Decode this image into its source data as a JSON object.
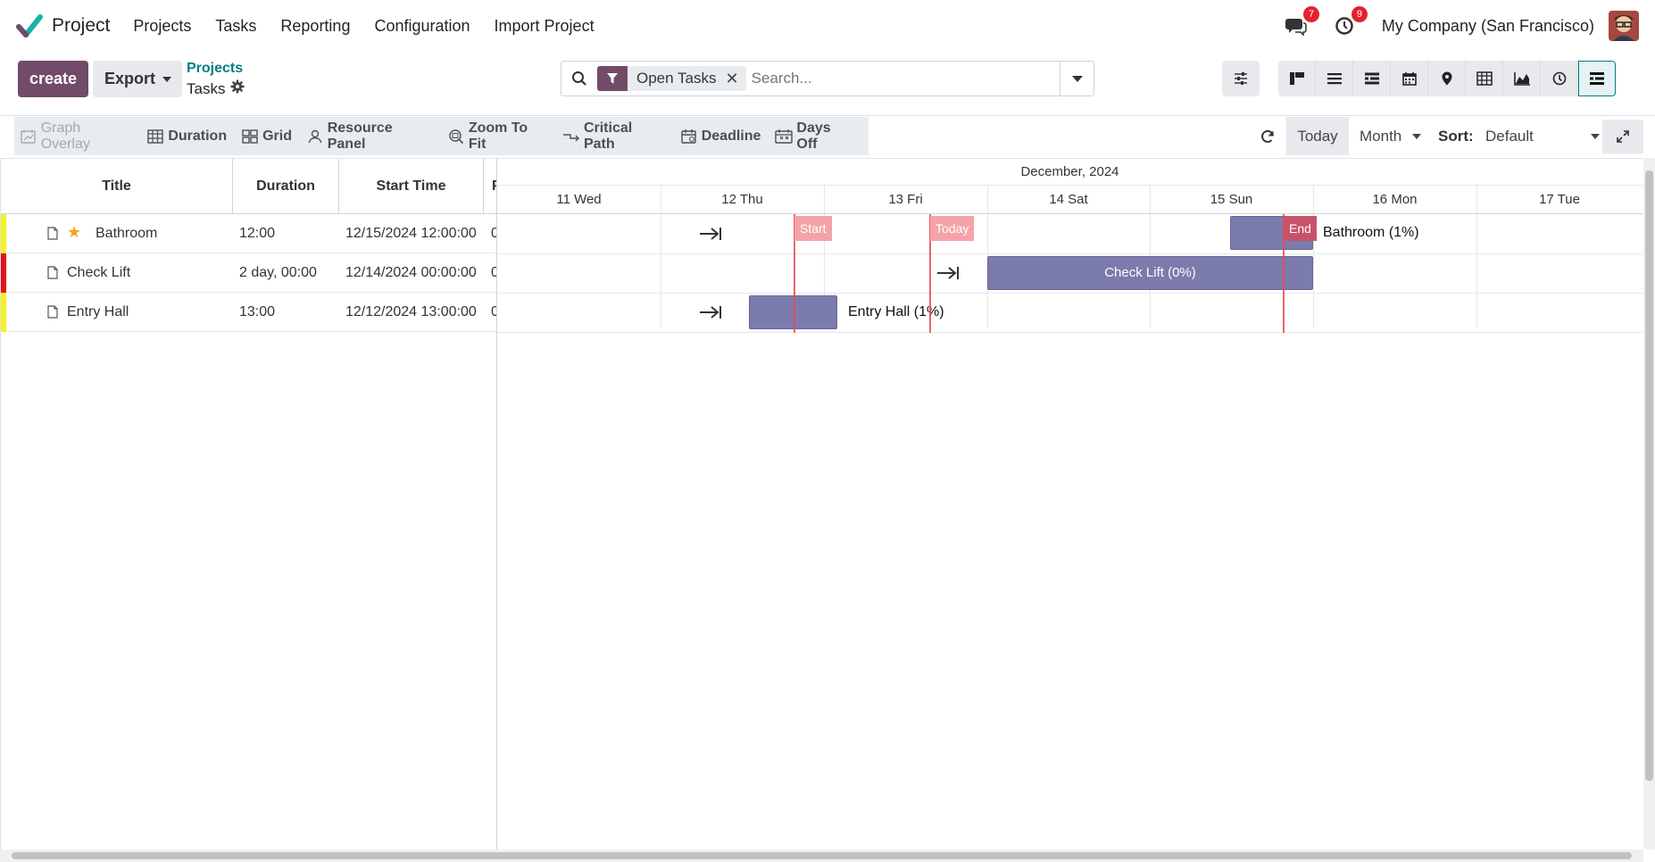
{
  "navbar": {
    "app_name": "Project",
    "menu": [
      "Projects",
      "Tasks",
      "Reporting",
      "Configuration",
      "Import Project"
    ],
    "messages_count": "7",
    "activities_count": "9",
    "company": "My Company (San Francisco)"
  },
  "control_panel": {
    "create_label": "create",
    "export_label": "Export",
    "breadcrumb_parent": "Projects",
    "breadcrumb_current": "Tasks",
    "facet_label": "Open Tasks",
    "search_placeholder": "Search..."
  },
  "gantt_toolbar": {
    "items": [
      "Graph Overlay",
      "Duration",
      "Grid",
      "Resource Panel",
      "Zoom To Fit",
      "Critical Path",
      "Deadline",
      "Days Off"
    ],
    "today_label": "Today",
    "range_label": "Month",
    "sort_label": "Sort:",
    "sort_value": "Default"
  },
  "table": {
    "columns": [
      "Title",
      "Duration",
      "Start Time",
      "P"
    ],
    "rows": [
      {
        "title": "Bathroom",
        "duration": "12:00",
        "start": "12/15/2024 12:00:00",
        "extra": "0",
        "flag": "#f5f125",
        "starred": true
      },
      {
        "title": "Check Lift",
        "duration": "2 day, 00:00",
        "start": "12/14/2024 00:00:00",
        "extra": "0",
        "flag": "#e5101d",
        "starred": false
      },
      {
        "title": "Entry Hall",
        "duration": "13:00",
        "start": "12/12/2024 13:00:00",
        "extra": "0",
        "flag": "#f5f125",
        "starred": false
      }
    ]
  },
  "timeline": {
    "month": "December, 2024",
    "days": [
      "11 Wed",
      "12 Thu",
      "13 Fri",
      "14 Sat",
      "15 Sun",
      "16 Mon",
      "17 Tue"
    ],
    "markers": {
      "start": "Start",
      "today": "Today",
      "end": "End"
    },
    "bars": {
      "bathroom": "Bathroom (1%)",
      "check_lift": "Check Lift (0%)",
      "entry_hall": "Entry Hall (1%)"
    }
  },
  "colors": {
    "brand": "#714B67",
    "accent": "#017e84",
    "bar": "#7c7bad",
    "marker": "#e8495a"
  }
}
